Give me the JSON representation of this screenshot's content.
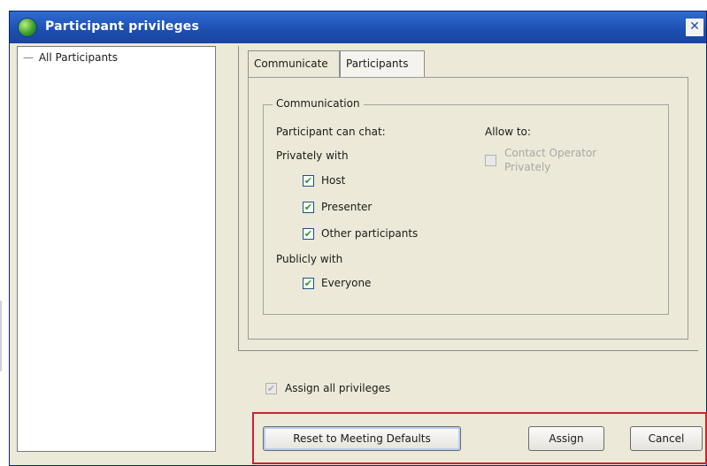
{
  "window": {
    "title": "Participant privileges",
    "close_label": "✕"
  },
  "tree": {
    "items": [
      {
        "label": "All Participants",
        "prefix": "—"
      }
    ]
  },
  "tabs": [
    {
      "label": "Communicate",
      "active": true
    },
    {
      "label": "Participants",
      "active": false
    }
  ],
  "communication": {
    "group_label": "Communication",
    "chat_heading": "Participant can chat:",
    "privately_label": "Privately with",
    "private_options": [
      {
        "label": "Host",
        "checked": true
      },
      {
        "label": "Presenter",
        "checked": true
      },
      {
        "label": "Other participants",
        "checked": true
      }
    ],
    "publicly_label": "Publicly with",
    "public_options": [
      {
        "label": "Everyone",
        "checked": true
      }
    ],
    "allow_heading": "Allow to:",
    "allow_options": [
      {
        "label_line1": "Contact Operator",
        "label_line2": "Privately",
        "checked": false,
        "disabled": true
      }
    ]
  },
  "assign_all": {
    "label": "Assign all privileges",
    "checked": true,
    "disabled": true
  },
  "buttons": {
    "reset_label": "Reset to Meeting Defaults",
    "assign_label": "Assign",
    "cancel_label": "Cancel"
  },
  "icons": {
    "app": "globe-icon",
    "check_mark": "✔"
  },
  "colors": {
    "titlebar": "#1d4fb0",
    "dialog_bg": "#ece9d8",
    "highlight_frame": "#d2202e",
    "check": "#21a121"
  }
}
